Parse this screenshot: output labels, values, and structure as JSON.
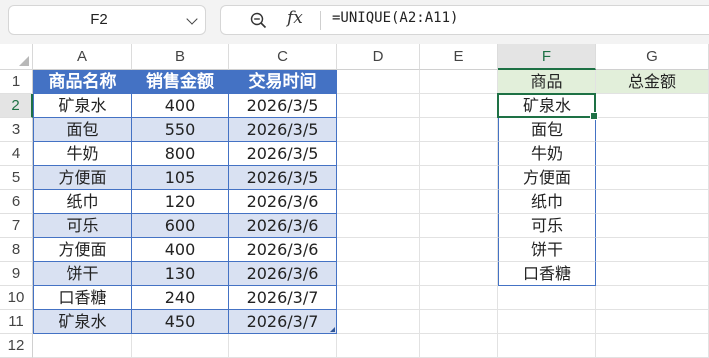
{
  "name_box": {
    "value": "F2"
  },
  "formula_bar": {
    "fx_label": "fx",
    "formula": "=UNIQUE(A2:A11)"
  },
  "columns": [
    "A",
    "B",
    "C",
    "D",
    "E",
    "F",
    "G"
  ],
  "rows": [
    "1",
    "2",
    "3",
    "4",
    "5",
    "6",
    "7",
    "8",
    "9",
    "10",
    "11",
    "12"
  ],
  "active_cell": {
    "column": "F",
    "row": "2"
  },
  "table": {
    "headers": [
      "商品名称",
      "销售金额",
      "交易时间"
    ],
    "rows": [
      [
        "矿泉水",
        "400",
        "2026/3/5"
      ],
      [
        "面包",
        "550",
        "2026/3/5"
      ],
      [
        "牛奶",
        "800",
        "2026/3/5"
      ],
      [
        "方便面",
        "105",
        "2026/3/5"
      ],
      [
        "纸巾",
        "120",
        "2026/3/6"
      ],
      [
        "可乐",
        "600",
        "2026/3/6"
      ],
      [
        "方便面",
        "400",
        "2026/3/6"
      ],
      [
        "饼干",
        "130",
        "2026/3/6"
      ],
      [
        "口香糖",
        "240",
        "2026/3/7"
      ],
      [
        "矿泉水",
        "450",
        "2026/3/7"
      ]
    ]
  },
  "summary": {
    "headers": [
      "商品",
      "总金额"
    ],
    "unique_items": [
      "矿泉水",
      "面包",
      "牛奶",
      "方便面",
      "纸巾",
      "可乐",
      "饼干",
      "口香糖"
    ]
  },
  "colors": {
    "table_header": "#4472c4",
    "band": "#d9e1f2",
    "summary_header": "#e2efda",
    "selection": "#1e7145"
  }
}
